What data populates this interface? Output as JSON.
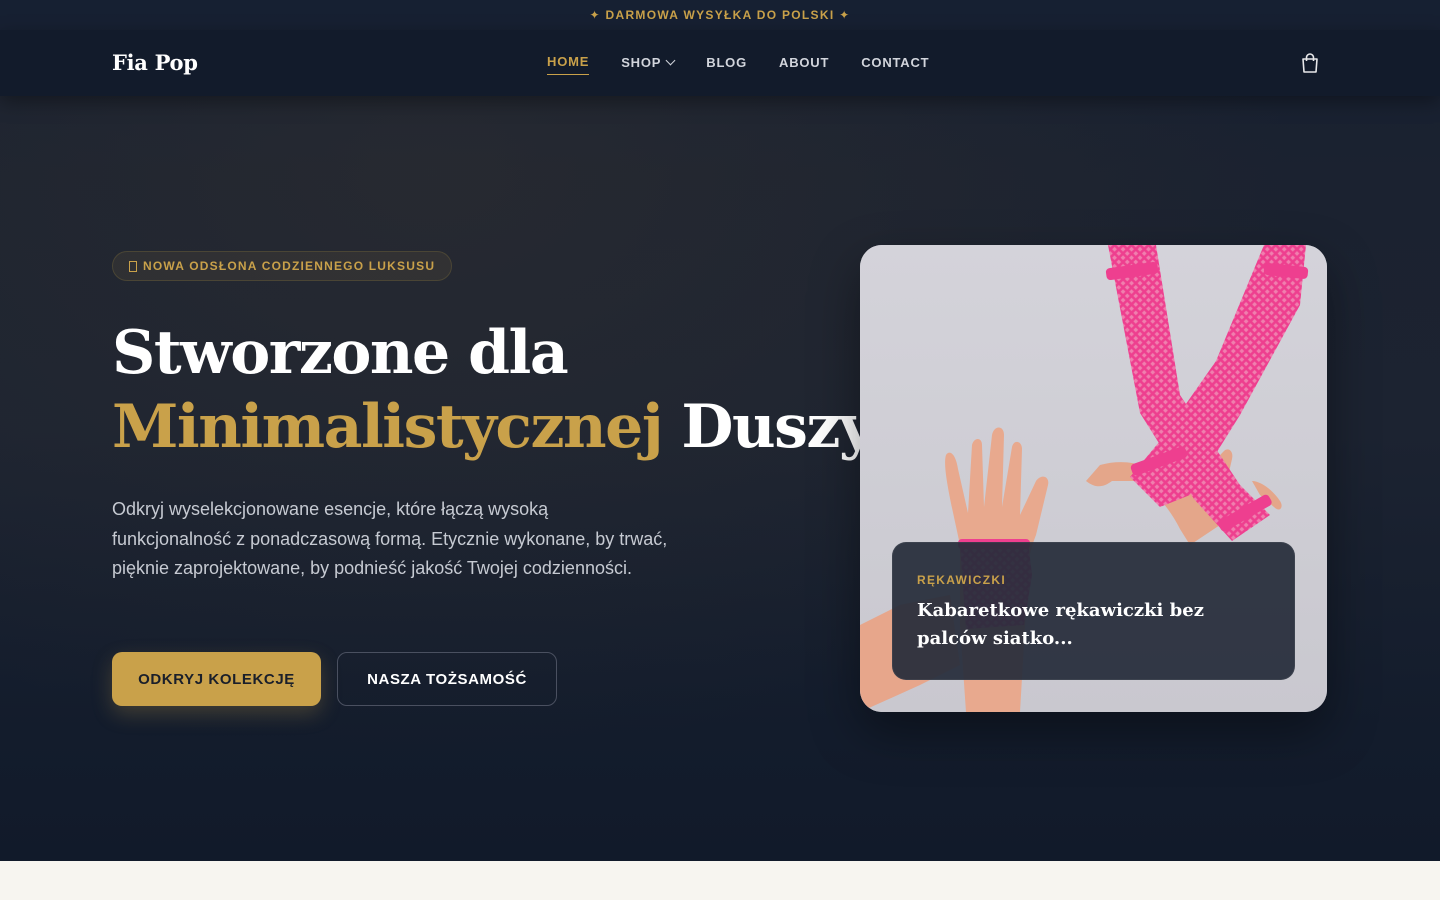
{
  "announcement": "✦ DARMOWA WYSYŁKA DO POLSKI ✦",
  "header": {
    "logo": "Fia Pop",
    "nav": [
      {
        "label": "HOME",
        "active": true
      },
      {
        "label": "SHOP",
        "dropdown": true
      },
      {
        "label": "BLOG"
      },
      {
        "label": "ABOUT"
      },
      {
        "label": "CONTACT"
      }
    ],
    "cart_icon": "shopping-bag-icon"
  },
  "hero": {
    "badge": "NOWA ODSŁONA CODZIENNEGO LUKSUSU",
    "headline_line1": "Stworzone dla",
    "headline_gold": "Minimalistycznej",
    "headline_end": " Duszy.",
    "description": "Odkryj wyselekcjonowane esencje, które łączą wysoką funkcjonalność z ponadczasową formą. Etycznie wykonane, by trwać, pięknie zaprojektowane, by podnieść jakość Twojej codzienności.",
    "primary_button": "ODKRYJ KOLEKCJĘ",
    "secondary_button": "NASZA TOŻSAMOŚĆ"
  },
  "featured": {
    "category": "RĘKAWICZKI",
    "title": "Kabaretkowe rękawiczki bez palców siatko..."
  },
  "colors": {
    "accent": "#c9a14a",
    "background": "#1b2230",
    "product_pink": "#ee3f8f"
  }
}
